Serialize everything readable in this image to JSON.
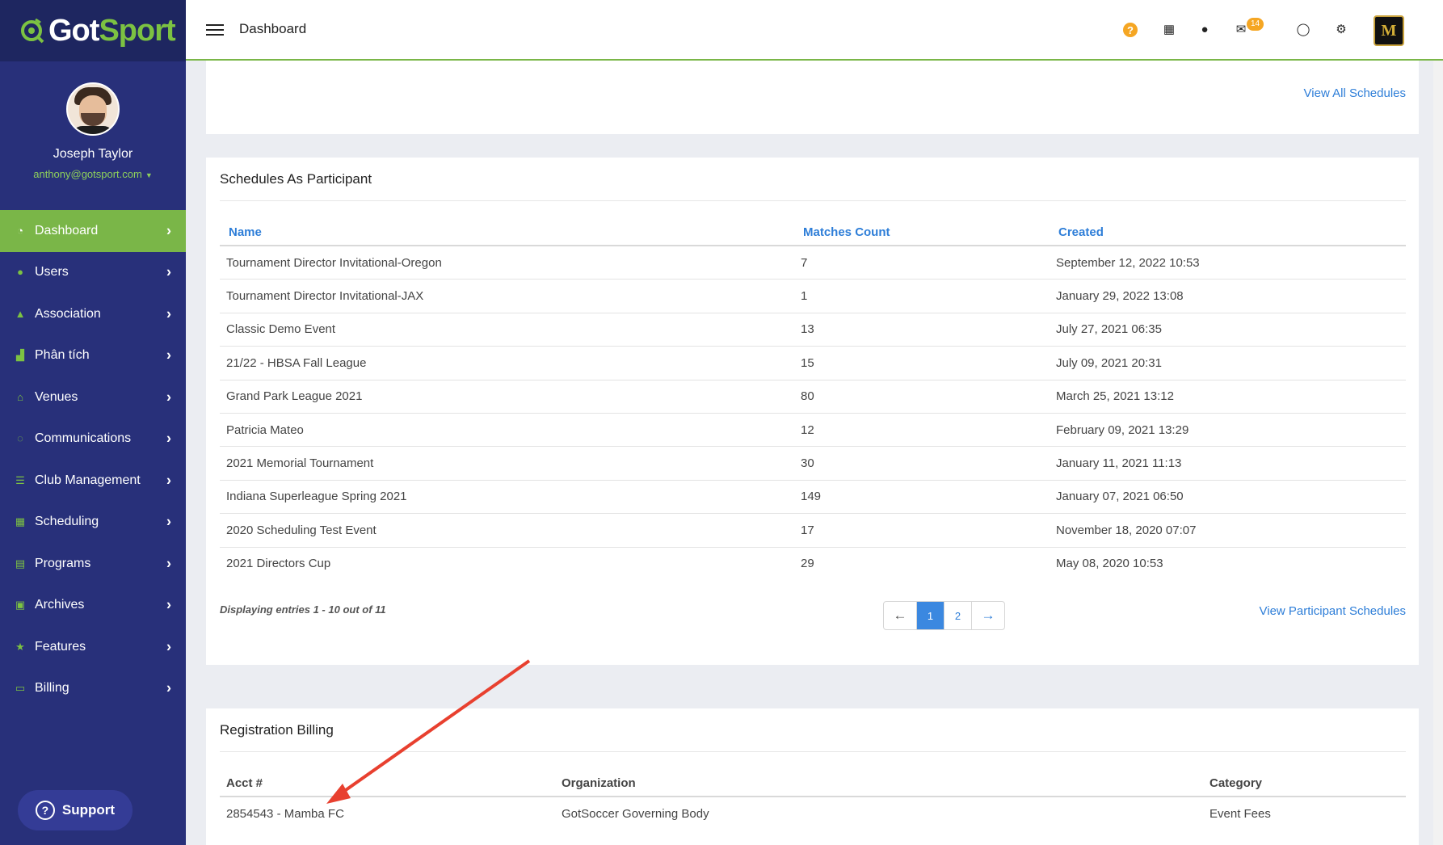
{
  "brand": {
    "got": "Got",
    "sport": "Sport"
  },
  "profile": {
    "name": "Joseph Taylor",
    "email": "anthony@gotsport.com"
  },
  "nav": {
    "items": [
      {
        "label": "Dashboard",
        "icon": "dashboard-icon"
      },
      {
        "label": "Users",
        "icon": "users-icon"
      },
      {
        "label": "Association",
        "icon": "sitemap-icon"
      },
      {
        "label": "Phân tích",
        "icon": "chart-icon"
      },
      {
        "label": "Venues",
        "icon": "home-icon"
      },
      {
        "label": "Communications",
        "icon": "chat-icon"
      },
      {
        "label": "Club Management",
        "icon": "list-icon"
      },
      {
        "label": "Scheduling",
        "icon": "calendar-icon"
      },
      {
        "label": "Programs",
        "icon": "document-icon"
      },
      {
        "label": "Archives",
        "icon": "archive-icon"
      },
      {
        "label": "Features",
        "icon": "star-icon"
      },
      {
        "label": "Billing",
        "icon": "credit-card-icon"
      }
    ]
  },
  "support": {
    "label": "Support"
  },
  "header": {
    "title": "Dashboard",
    "mail_count": "14",
    "logo_letter": "M"
  },
  "top_panel": {
    "view_all": "View All Schedules"
  },
  "schedules": {
    "title": "Schedules As Participant",
    "columns": [
      "Name",
      "Matches Count",
      "Created"
    ],
    "rows": [
      [
        "Tournament Director Invitational-Oregon",
        "7",
        "September 12, 2022 10:53"
      ],
      [
        "Tournament Director Invitational-JAX",
        "1",
        "January 29, 2022 13:08"
      ],
      [
        "Classic Demo Event",
        "13",
        "July 27, 2021 06:35"
      ],
      [
        "21/22 - HBSA Fall League",
        "15",
        "July 09, 2021 20:31"
      ],
      [
        "Grand Park League 2021",
        "80",
        "March 25, 2021 13:12"
      ],
      [
        "Patricia Mateo",
        "12",
        "February 09, 2021 13:29"
      ],
      [
        "2021 Memorial Tournament",
        "30",
        "January 11, 2021 11:13"
      ],
      [
        "Indiana Superleague Spring 2021",
        "149",
        "January 07, 2021 06:50"
      ],
      [
        "2020 Scheduling Test Event",
        "17",
        "November 18, 2020 07:07"
      ],
      [
        "2021 Directors Cup",
        "29",
        "May 08, 2020 10:53"
      ]
    ],
    "entries": "Displaying entries 1 - 10 out of 11",
    "pager": {
      "prev": "←",
      "page1": "1",
      "page2": "2",
      "next": "→"
    },
    "view_link": "View Participant Schedules"
  },
  "billing": {
    "title": "Registration Billing",
    "columns": [
      "Acct #",
      "Organization",
      "Category"
    ],
    "rows": [
      [
        "2854543 - Mamba FC",
        "GotSoccer Governing Body",
        "Event Fees"
      ]
    ]
  },
  "colors": {
    "sidebar": "#28307a",
    "accent_green": "#7ab648",
    "link": "#2e7ed8",
    "badge": "#f5a623",
    "arrow": "#e8402f"
  }
}
